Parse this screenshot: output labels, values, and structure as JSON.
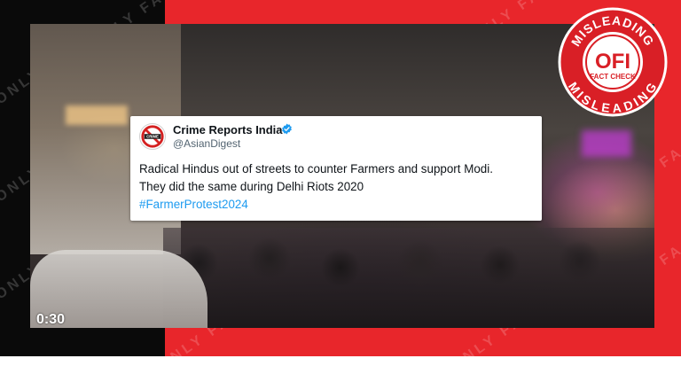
{
  "watermark": {
    "text": "ONLY FACT"
  },
  "tweet": {
    "display_name": "Crime Reports India",
    "handle": "@AsianDigest",
    "avatar_text": "CRIME",
    "lines": [
      "Radical Hindus out of streets to counter Farmers and support Modi.",
      "They did the same during Delhi Riots 2020"
    ],
    "hashtag": "#FarmerProtest2024"
  },
  "video": {
    "duration": "0:30"
  },
  "stamp": {
    "top_text": "MISLEADING",
    "center_text": "OFI",
    "sub_text": "FACT CHECK",
    "bottom_text": "MISLEADING"
  },
  "colors": {
    "frame_red": "#e8262b",
    "frame_black": "#0a0a0a",
    "link_blue": "#1d9bf0",
    "verified_blue": "#1d9bf0"
  },
  "icons": {
    "verified": "verified-badge-icon",
    "avatar": "no-crime-sign-icon"
  }
}
